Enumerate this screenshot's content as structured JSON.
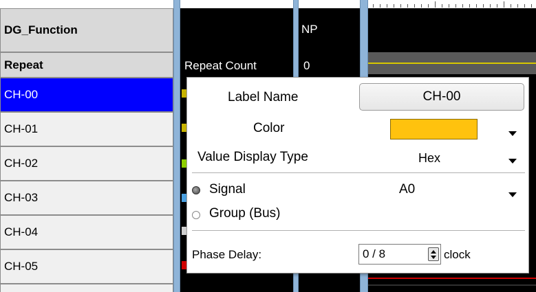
{
  "channel_list": {
    "header_function": "DG_Function",
    "header_repeat": "Repeat",
    "channels": [
      "CH-00",
      "CH-01",
      "CH-02",
      "CH-03",
      "CH-04",
      "CH-05"
    ],
    "selected": "CH-00"
  },
  "columns": {
    "np_label": "NP",
    "repeat_count_label": "Repeat Count",
    "repeat_count_value": "0"
  },
  "popup": {
    "label_name_label": "Label Name",
    "label_name_value": "CH-00",
    "color_label": "Color",
    "color_value": "#ffc20e",
    "value_display_type_label": "Value Display Type",
    "value_display_type_value": "Hex",
    "signal_label": "Signal",
    "signal_value": "A0",
    "signal_selected": true,
    "group_label": "Group (Bus)",
    "phase_delay_label": "Phase Delay:",
    "phase_delay_value": "0 / 8",
    "phase_delay_unit": "clock"
  },
  "icons": [
    "dropdown-arrow-icon",
    "radio-icon",
    "spinner-icon"
  ]
}
